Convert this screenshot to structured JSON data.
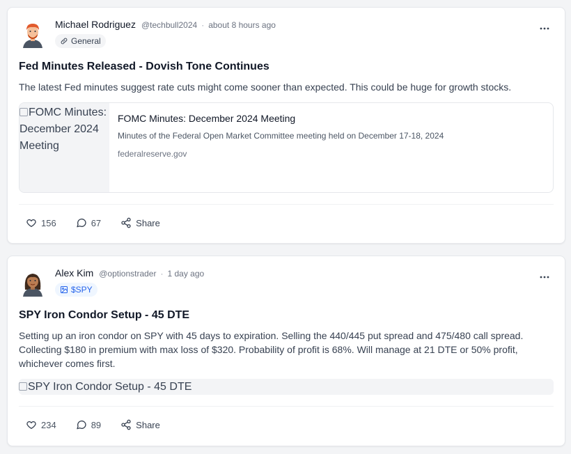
{
  "posts": [
    {
      "author": "Michael Rodriguez",
      "handle": "@techbull2024",
      "separator": "·",
      "time": "about 8 hours ago",
      "tag": "General",
      "title": "Fed Minutes Released - Dovish Tone Continues",
      "body": "The latest Fed minutes suggest rate cuts might come sooner than expected. This could be huge for growth stocks.",
      "link": {
        "image_alt": "FOMC Minutes: December 2024 Meeting",
        "title": "FOMC Minutes: December 2024 Meeting",
        "description": "Minutes of the Federal Open Market Committee meeting held on December 17-18, 2024",
        "domain": "federalreserve.gov"
      },
      "likes": "156",
      "comments": "67",
      "share_label": "Share"
    },
    {
      "author": "Alex Kim",
      "handle": "@optionstrader",
      "separator": "·",
      "time": "1 day ago",
      "tag": "$SPY",
      "title": "SPY Iron Condor Setup - 45 DTE",
      "body": "Setting up an iron condor on SPY with 45 days to expiration. Selling the 440/445 put spread and 475/480 call spread. Collecting $180 in premium with max loss of $320. Probability of profit is 68%. Will manage at 21 DTE or 50% profit, whichever comes first.",
      "image_alt": "SPY Iron Condor Setup - 45 DTE",
      "likes": "234",
      "comments": "89",
      "share_label": "Share"
    }
  ],
  "icons": {
    "more": "ellipsis-horizontal-icon",
    "like": "heart-icon",
    "comment": "comment-icon",
    "share": "share-icon",
    "tag_general": "link-icon",
    "tag_ticker": "image-icon"
  },
  "colors": {
    "ticker_tag_text": "#2563eb",
    "ticker_tag_bg": "#eff6ff"
  }
}
